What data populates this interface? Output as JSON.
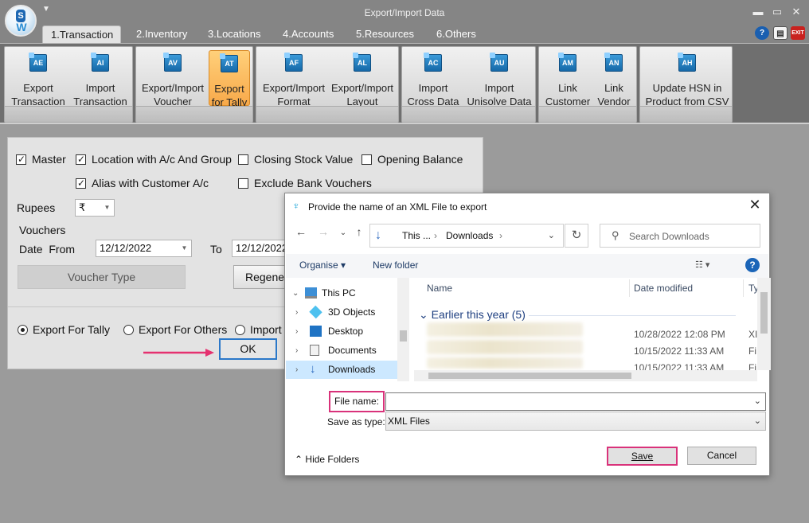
{
  "window": {
    "title": "Export/Import Data",
    "tabs": [
      {
        "label": "1.Transaction"
      },
      {
        "label": "2.Inventory"
      },
      {
        "label": "3.Locations"
      },
      {
        "label": "4.Accounts"
      },
      {
        "label": "5.Resources"
      },
      {
        "label": "6.Others"
      }
    ],
    "active_tab": "1.Transaction",
    "exit_label": "EXIT"
  },
  "ribbon": {
    "buttons": [
      {
        "label": "Export\nTransaction",
        "icon": "AE"
      },
      {
        "label": "Import\nTransaction",
        "icon": "AI"
      },
      {
        "label": "Export/Import\nVoucher",
        "icon": "AV"
      },
      {
        "label": "Export\nfor Tally",
        "icon": "AT"
      },
      {
        "label": "Export/Import\nFormat",
        "icon": "AF"
      },
      {
        "label": "Export/Import\nLayout",
        "icon": "AL"
      },
      {
        "label": "Import\nCross Data",
        "icon": "AC"
      },
      {
        "label": "Import\nUnisolve Data",
        "icon": "AU"
      },
      {
        "label": "Link\nCustomer",
        "icon": "AM"
      },
      {
        "label": "Link\nVendor",
        "icon": "AN"
      },
      {
        "label": "Update HSN in\nProduct from CSV",
        "icon": "AH"
      }
    ],
    "active_button": "Export for Tally"
  },
  "form": {
    "master": "Master",
    "location": "Location with A/c And Group",
    "closing_stock": "Closing Stock Value",
    "opening_balance": "Opening Balance",
    "alias": "Alias with Customer A/c",
    "exclude_bank": "Exclude Bank Vouchers",
    "rupees_label": "Rupees",
    "rupees_value": "₹",
    "vouchers_label": "Vouchers",
    "date_from_label": "Date  From",
    "date_from": "12/12/2022",
    "to_label": "To",
    "date_to": "12/12/2022",
    "voucher_type": "Voucher Type",
    "regenerate": "Regene",
    "export_tally": "Export For Tally",
    "export_others": "Export For Others",
    "import": "Import",
    "ok": "OK"
  },
  "dialog": {
    "title": "Provide the name of an XML File to export",
    "breadcrumb": [
      "This ...",
      "Downloads"
    ],
    "search_placeholder": "Search Downloads",
    "organise": "Organise",
    "new_folder": "New folder",
    "nav_items": [
      "This PC",
      "3D Objects",
      "Desktop",
      "Documents",
      "Downloads"
    ],
    "columns": [
      "Name",
      "Date modified",
      "Ty"
    ],
    "group_header": "Earlier this year (5)",
    "files": [
      {
        "date": "10/28/2022 12:08 PM",
        "type": "XI"
      },
      {
        "date": "10/15/2022 11:33 AM",
        "type": "Fi"
      },
      {
        "date": "10/15/2022 11:33 AM",
        "type": "Fi"
      }
    ],
    "file_name_label": "File name:",
    "file_name_value": "",
    "save_as_label": "Save as type:",
    "save_as_value": "XML Files",
    "hide_folders": "Hide Folders",
    "save": "Save",
    "cancel": "Cancel"
  },
  "colors": {
    "accent": "#2b78c9",
    "highlight_border": "#d9327a",
    "active_ribbon": "#f8a94a"
  }
}
